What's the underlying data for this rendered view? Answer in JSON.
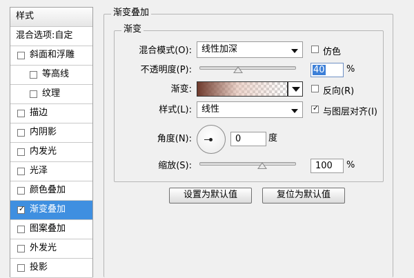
{
  "colors": {
    "selection": "#3f8fe0",
    "gradient_start": "#6e3a2c"
  },
  "styles_list": [
    {
      "label": "样式",
      "has_checkbox": false,
      "checked": false,
      "indent": 0,
      "header": true
    },
    {
      "label": "混合选项:自定",
      "has_checkbox": false,
      "checked": false,
      "indent": 0
    },
    {
      "label": "斜面和浮雕",
      "has_checkbox": true,
      "checked": false,
      "indent": 0
    },
    {
      "label": "等高线",
      "has_checkbox": true,
      "checked": false,
      "indent": 1
    },
    {
      "label": "纹理",
      "has_checkbox": true,
      "checked": false,
      "indent": 1
    },
    {
      "label": "描边",
      "has_checkbox": true,
      "checked": false,
      "indent": 0
    },
    {
      "label": "内阴影",
      "has_checkbox": true,
      "checked": false,
      "indent": 0
    },
    {
      "label": "内发光",
      "has_checkbox": true,
      "checked": false,
      "indent": 0
    },
    {
      "label": "光泽",
      "has_checkbox": true,
      "checked": false,
      "indent": 0
    },
    {
      "label": "颜色叠加",
      "has_checkbox": true,
      "checked": false,
      "indent": 0
    },
    {
      "label": "渐变叠加",
      "has_checkbox": true,
      "checked": true,
      "indent": 0,
      "selected": true
    },
    {
      "label": "图案叠加",
      "has_checkbox": true,
      "checked": false,
      "indent": 0
    },
    {
      "label": "外发光",
      "has_checkbox": true,
      "checked": false,
      "indent": 0
    },
    {
      "label": "投影",
      "has_checkbox": true,
      "checked": false,
      "indent": 0
    }
  ],
  "panel": {
    "outer_title": "渐变叠加",
    "inner_title": "渐变",
    "blend_mode": {
      "label": "混合模式(O):",
      "value": "线性加深"
    },
    "dither": {
      "label": "仿色",
      "checked": false
    },
    "opacity": {
      "label": "不透明度(P):",
      "value": "40",
      "unit": "%",
      "level": 40
    },
    "gradient": {
      "label": "渐变:"
    },
    "reverse": {
      "label": "反向(R)",
      "checked": false
    },
    "style": {
      "label": "样式(L):",
      "value": "线性"
    },
    "align_with_layer": {
      "label": "与图层对齐(I)",
      "checked": true
    },
    "angle": {
      "label": "角度(N):",
      "value": "0",
      "unit": "度"
    },
    "scale": {
      "label": "缩放(S):",
      "value": "100",
      "unit": "%",
      "level": 65
    },
    "buttons": {
      "make_default": "设置为默认值",
      "reset_default": "复位为默认值"
    }
  }
}
